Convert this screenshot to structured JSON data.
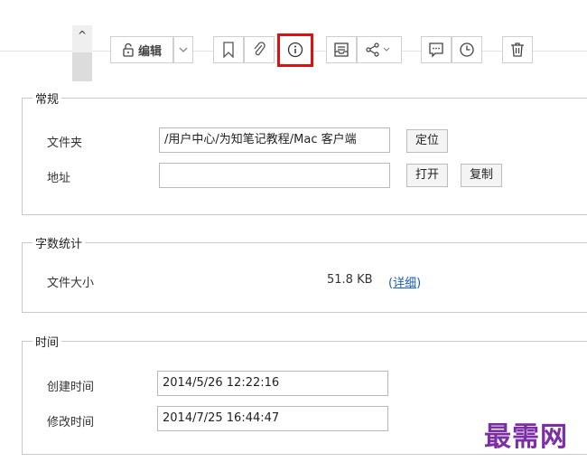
{
  "toolbar": {
    "edit_label": "编辑",
    "icons": [
      "lock-icon",
      "chevron-down-icon",
      "bookmark-icon",
      "attachment-icon",
      "info-icon",
      "print-icon",
      "share-icon",
      "comment-icon",
      "history-icon",
      "trash-icon"
    ],
    "highlight_color": "#dd1111"
  },
  "general": {
    "legend": "常规",
    "folder_label": "文件夹",
    "folder_value": "/用户中心/为知笔记教程/Mac 客户端",
    "locate_button": "定位",
    "address_label": "地址",
    "address_value": "",
    "open_button": "打开",
    "copy_button": "复制"
  },
  "wordcount": {
    "legend": "字数统计",
    "filesize_label": "文件大小",
    "filesize_value": "51.8 KB",
    "details_open": "(",
    "details_link": "详细",
    "details_close": ")"
  },
  "time": {
    "legend": "时间",
    "created_label": "创建时间",
    "created_value": "2014/5/26 12:22:16",
    "modified_label": "修改时间",
    "modified_value": "2014/7/25 16:44:47"
  },
  "watermark": "最需网"
}
